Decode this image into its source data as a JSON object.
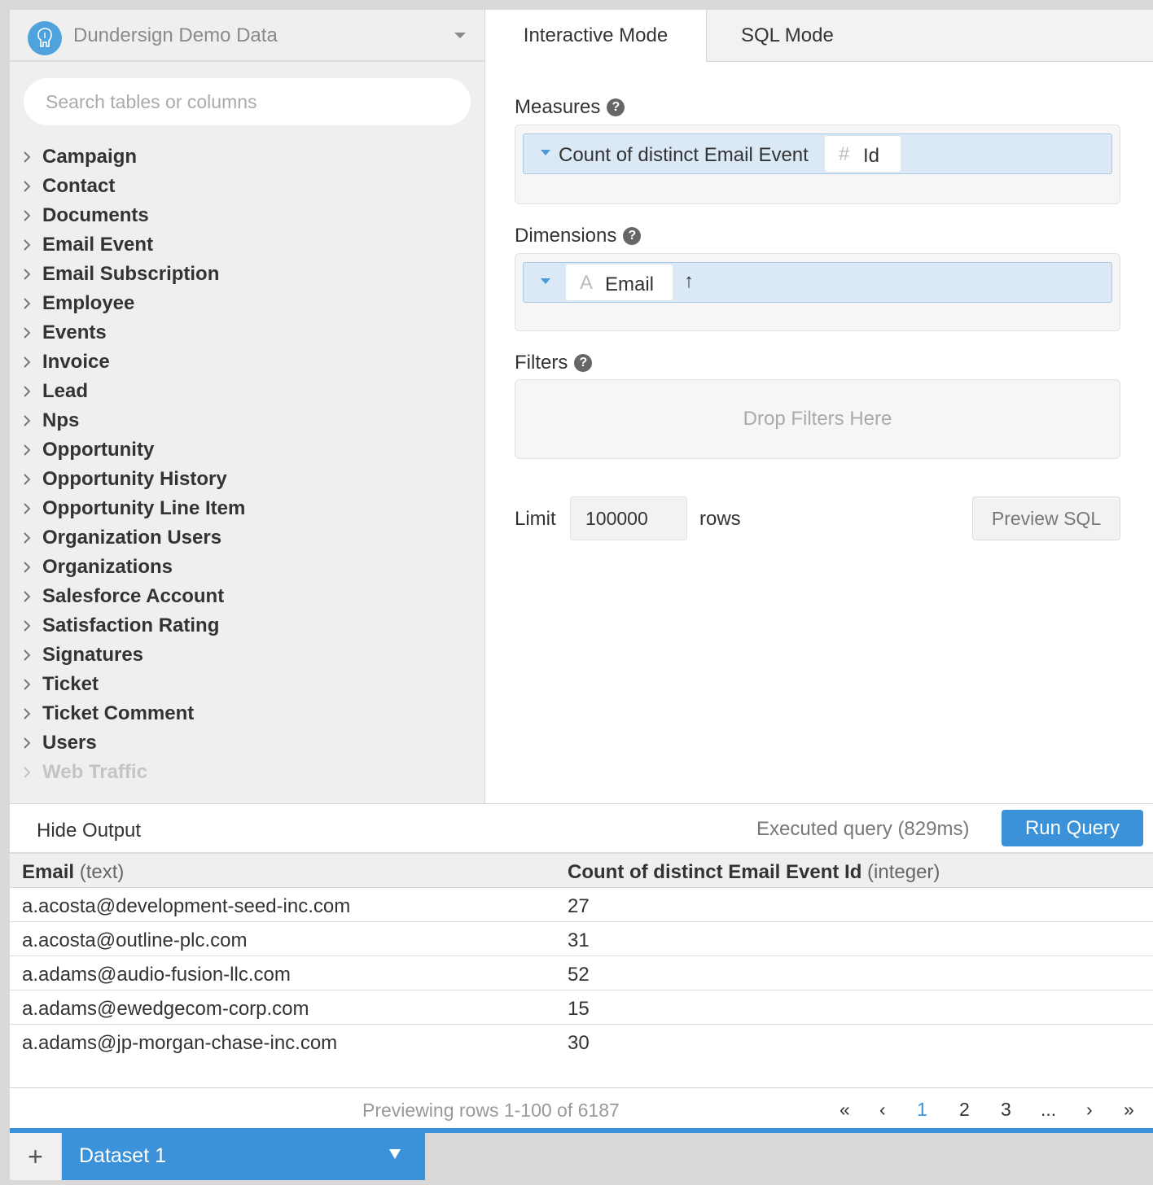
{
  "datasource": {
    "name": "Dundersign Demo Data",
    "icon": "postgres-elephant-icon"
  },
  "search": {
    "placeholder": "Search tables or columns",
    "value": ""
  },
  "tables": [
    "Campaign",
    "Contact",
    "Documents",
    "Email Event",
    "Email Subscription",
    "Employee",
    "Events",
    "Invoice",
    "Lead",
    "Nps",
    "Opportunity",
    "Opportunity History",
    "Opportunity Line Item",
    "Organization Users",
    "Organizations",
    "Salesforce Account",
    "Satisfaction Rating",
    "Signatures",
    "Ticket",
    "Ticket Comment",
    "Users",
    "Web Traffic"
  ],
  "tabs": {
    "interactive": "Interactive Mode",
    "sql": "SQL Mode"
  },
  "measures": {
    "label": "Measures",
    "help": "?",
    "item": {
      "prefix": "Count of distinct Email Event",
      "field_icon": "#",
      "field": "Id"
    }
  },
  "dimensions": {
    "label": "Dimensions",
    "help": "?",
    "item": {
      "field_icon": "A",
      "field": "Email",
      "sort_icon": "↑"
    }
  },
  "filters": {
    "label": "Filters",
    "help": "?",
    "placeholder": "Drop Filters Here"
  },
  "limit": {
    "label": "Limit",
    "value": "100000",
    "unit": "rows"
  },
  "preview_sql": "Preview SQL",
  "output": {
    "hide_label": "Hide Output",
    "status": "Executed query (829ms)",
    "run_label": "Run Query"
  },
  "results": {
    "columns": [
      {
        "name": "Email",
        "type": "(text)"
      },
      {
        "name": "Count of distinct Email Event Id",
        "type": "(integer)"
      }
    ],
    "rows": [
      [
        "a.acosta@development-seed-inc.com",
        "27"
      ],
      [
        "a.acosta@outline-plc.com",
        "31"
      ],
      [
        "a.adams@audio-fusion-llc.com",
        "52"
      ],
      [
        "a.adams@ewedgecom-corp.com",
        "15"
      ],
      [
        "a.adams@jp-morgan-chase-inc.com",
        "30"
      ]
    ]
  },
  "pagination": {
    "summary": "Previewing rows 1-100 of 6187",
    "first": "«",
    "prev": "‹",
    "pages": [
      "1",
      "2",
      "3"
    ],
    "ellipsis": "...",
    "next": "›",
    "last": "»",
    "current": "1"
  },
  "bottom": {
    "add": "+",
    "dataset": "Dataset 1"
  },
  "colors": {
    "accent": "#3c92d8",
    "pill_bg": "#dbe9f6"
  }
}
